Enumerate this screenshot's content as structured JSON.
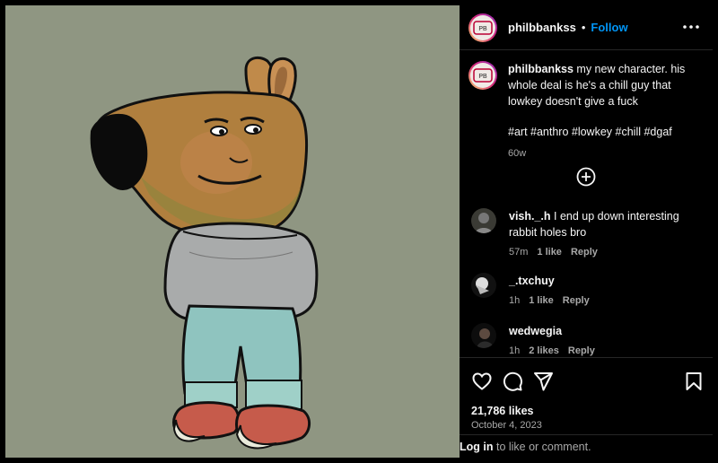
{
  "post": {
    "username": "philbbankss",
    "separator": "•",
    "follow_label": "Follow",
    "caption_text": "my new character. his whole deal is he's a chill guy that lowkey doesn't give a fuck",
    "hashtags": "#art #anthro #lowkey #chill #dgaf",
    "caption_time": "60w",
    "likes": "21,786 likes",
    "date": "October 4, 2023"
  },
  "comments": [
    {
      "username": "vish._.h",
      "text": "I end up down interesting rabbit holes bro",
      "time": "57m",
      "likes": "1 like",
      "reply": "Reply"
    },
    {
      "username": "_.txchuy",
      "text": "",
      "time": "1h",
      "likes": "1 like",
      "reply": "Reply"
    },
    {
      "username": "wedwegia",
      "text": "",
      "time": "1h",
      "likes": "2 likes",
      "reply": "Reply"
    }
  ],
  "login": {
    "link": "Log in",
    "rest": " to like or comment."
  },
  "icons": {
    "more": "more-options-icon",
    "add": "add-circle-icon",
    "like": "heart-icon",
    "comment": "comment-icon",
    "share": "send-icon",
    "save": "bookmark-icon"
  },
  "colors": {
    "background": "#000000",
    "canvas": "#8f9682",
    "follow": "#0095f6",
    "muted": "#a8a8a8"
  }
}
